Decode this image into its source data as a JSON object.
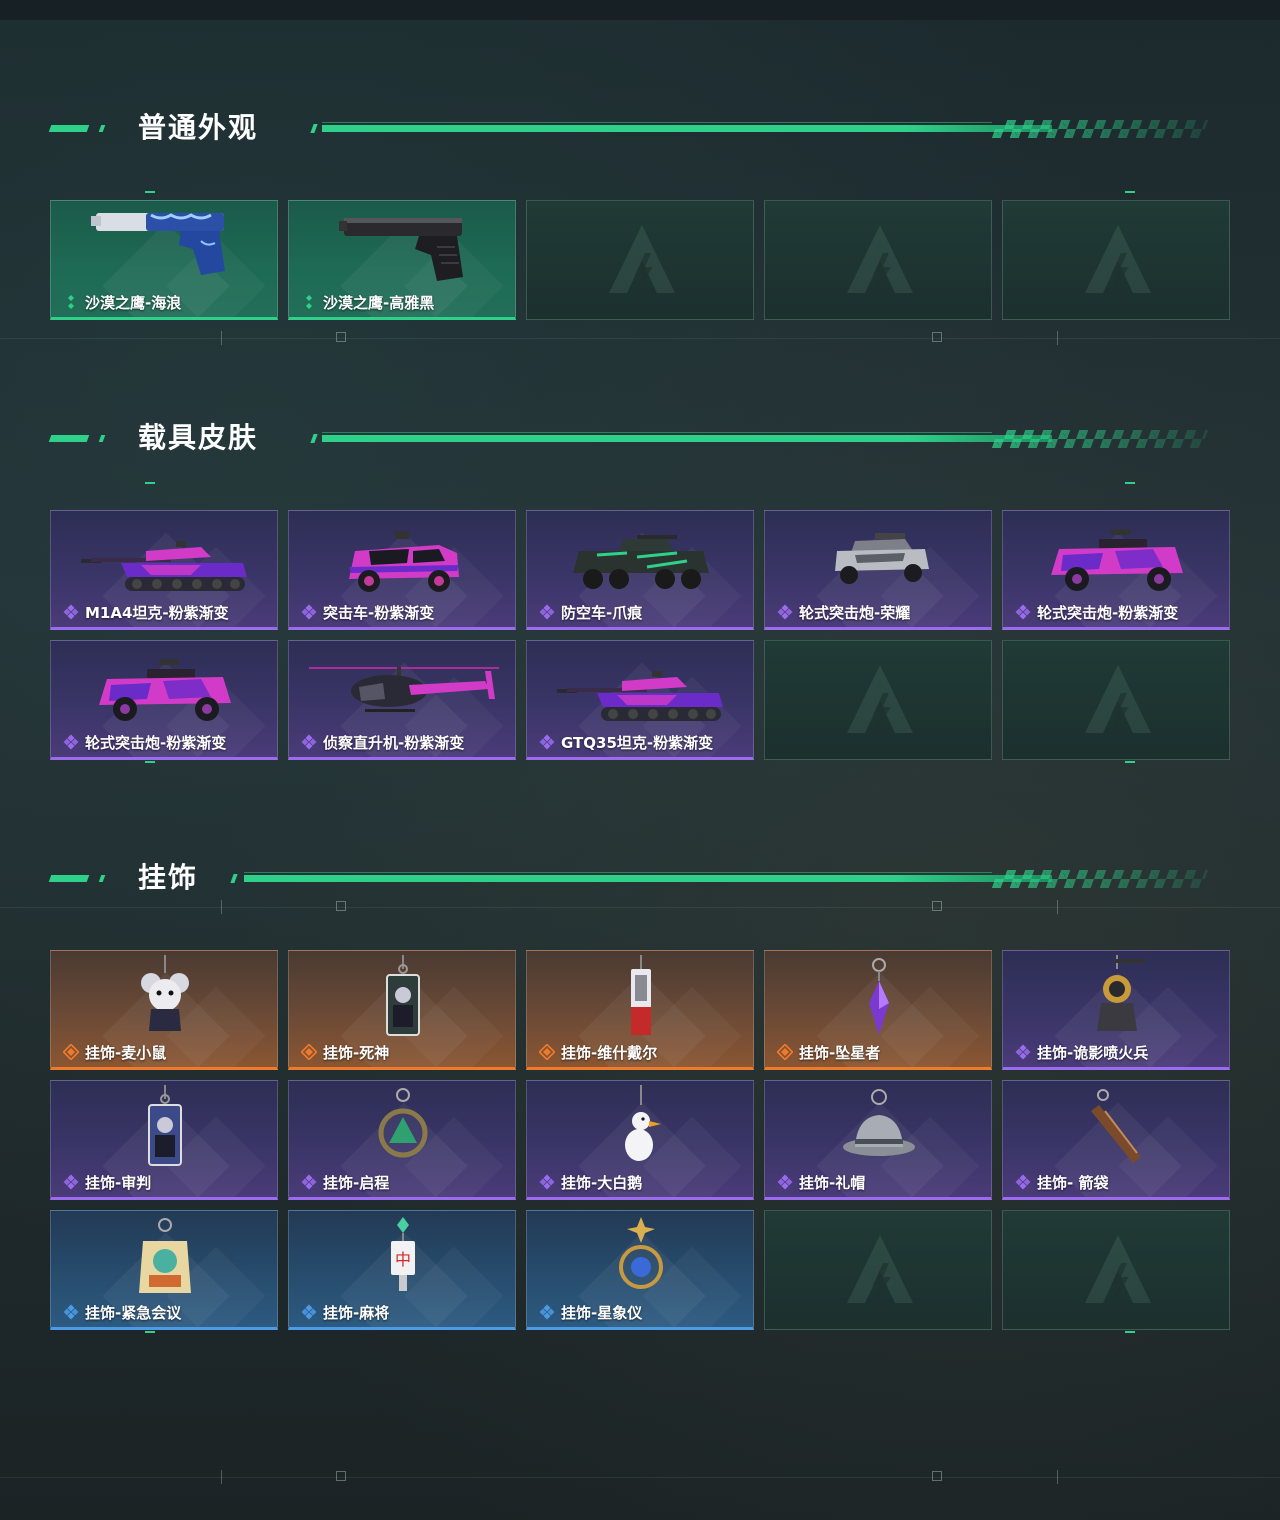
{
  "sections": {
    "weapon": {
      "title": "普通外观",
      "items": [
        {
          "label": "沙漠之鹰-海浪",
          "rarity": "green",
          "icon": "pistol-blue-wave-icon"
        },
        {
          "label": "沙漠之鹰-高雅黑",
          "rarity": "green",
          "icon": "pistol-black-icon"
        }
      ]
    },
    "vehicle": {
      "title": "载具皮肤",
      "items": [
        {
          "label": "M1A4坦克-粉紫渐变",
          "rarity": "purple",
          "icon": "tank-icon"
        },
        {
          "label": "突击车-粉紫渐变",
          "rarity": "purple",
          "icon": "assault-car-icon"
        },
        {
          "label": "防空车-爪痕",
          "rarity": "purple",
          "icon": "aa-vehicle-icon"
        },
        {
          "label": "轮式突击炮-荣耀",
          "rarity": "purple",
          "icon": "wheeled-gun-glory-icon"
        },
        {
          "label": "轮式突击炮-粉紫渐变",
          "rarity": "purple",
          "icon": "wheeled-gun-icon"
        },
        {
          "label": "轮式突击炮-粉紫渐变",
          "rarity": "purple",
          "icon": "wheeled-gun-icon"
        },
        {
          "label": "侦察直升机-粉紫渐变",
          "rarity": "purple",
          "icon": "helicopter-icon"
        },
        {
          "label": "GTQ35坦克-粉紫渐变",
          "rarity": "purple",
          "icon": "tank-icon"
        }
      ]
    },
    "charm": {
      "title": "挂饰",
      "items": [
        {
          "label": "挂饰-麦小鼠",
          "rarity": "orange",
          "icon": "mouse-charm-icon"
        },
        {
          "label": "挂饰-死神",
          "rarity": "orange",
          "icon": "reaper-card-charm-icon"
        },
        {
          "label": "挂饰-维什戴尔",
          "rarity": "orange",
          "icon": "tag-charm-icon"
        },
        {
          "label": "挂饰-坠星者",
          "rarity": "orange",
          "icon": "crystal-charm-icon"
        },
        {
          "label": "挂饰-诡影喷火兵",
          "rarity": "purple",
          "icon": "flamethrower-charm-icon"
        },
        {
          "label": "挂饰-审判",
          "rarity": "purple",
          "icon": "judgement-card-charm-icon"
        },
        {
          "label": "挂饰-启程",
          "rarity": "purple",
          "icon": "ring-charm-icon"
        },
        {
          "label": "挂饰-大白鹅",
          "rarity": "purple",
          "icon": "goose-charm-icon"
        },
        {
          "label": "挂饰-礼帽",
          "rarity": "purple",
          "icon": "hat-charm-icon"
        },
        {
          "label": "挂饰- 箭袋",
          "rarity": "purple",
          "icon": "quiver-charm-icon"
        },
        {
          "label": "挂饰-紧急会议",
          "rarity": "blue",
          "icon": "meeting-charm-icon"
        },
        {
          "label": "挂饰-麻将",
          "rarity": "blue",
          "icon": "mahjong-charm-icon"
        },
        {
          "label": "挂饰-星象仪",
          "rarity": "blue",
          "icon": "astrolabe-charm-icon"
        }
      ]
    }
  },
  "colors": {
    "accent": "#2fd18a",
    "green": "#2fd18a",
    "purple": "#9b6cf0",
    "orange": "#f07a2c",
    "blue": "#4d9ae8"
  }
}
